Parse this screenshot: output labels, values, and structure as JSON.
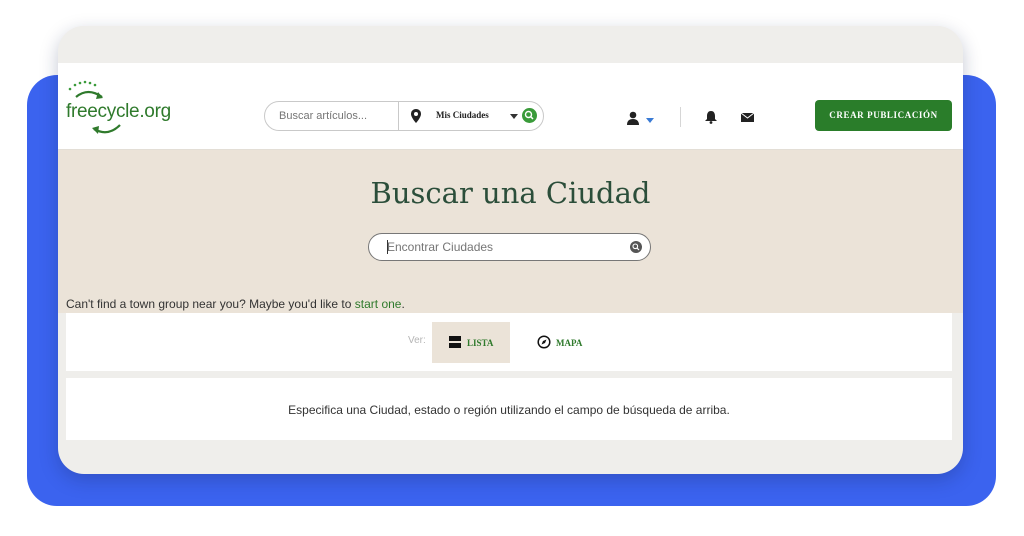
{
  "brand": {
    "logo_text": "freecycle.org"
  },
  "header": {
    "search_placeholder": "Buscar artículos...",
    "city_selector_label": "Mis Ciudades",
    "create_button_label": "CREAR PUBLICACIÓN"
  },
  "hero": {
    "title": "Buscar una Ciudad",
    "city_search_placeholder": "Encontrar Ciudades",
    "hint_prefix": "Can't find a town group near you? Maybe you'd like to ",
    "hint_link": "start one",
    "hint_suffix": "."
  },
  "view": {
    "label": "Ver:",
    "tabs": [
      {
        "label": "LISTA",
        "icon": "list-icon",
        "active": true
      },
      {
        "label": "MAPA",
        "icon": "compass-icon",
        "active": false
      }
    ]
  },
  "results": {
    "message": "Especifica una Ciudad, estado o región utilizando el campo de búsqueda de arriba."
  },
  "colors": {
    "brand_green": "#2a7d2a",
    "backdrop_blue": "#3b63ef",
    "hero_beige": "#ebe3d8",
    "title_green": "#2b4e3a"
  }
}
